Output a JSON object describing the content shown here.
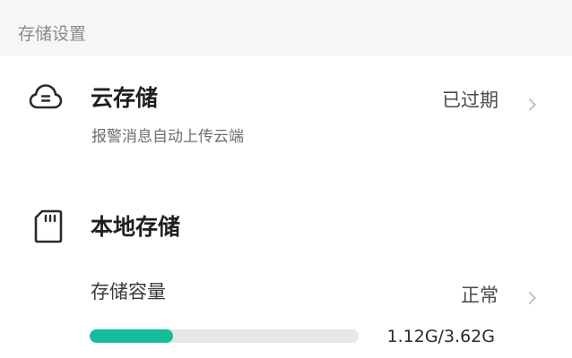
{
  "section": {
    "title": "存储设置"
  },
  "cloud_storage": {
    "title": "云存储",
    "subtitle": "报警消息自动上传云端",
    "status": "已过期",
    "icon": "cloud-icon"
  },
  "local_storage": {
    "title": "本地存储",
    "icon": "sd-card-icon",
    "capacity_label": "存储容量",
    "capacity_status": "正常",
    "usage_text": "1.12G/3.62G",
    "used_gb": 1.12,
    "total_gb": 3.62,
    "progress_fraction": 0.31
  },
  "colors": {
    "accent": "#16bd9a",
    "track": "#e7e7e7"
  }
}
